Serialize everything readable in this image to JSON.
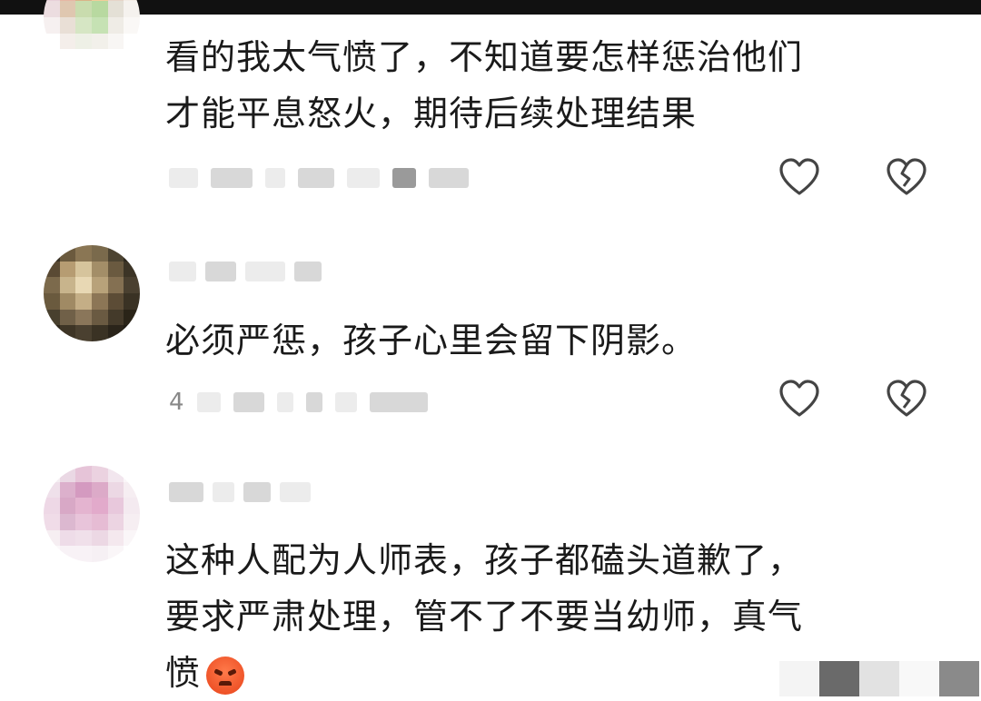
{
  "comments": [
    {
      "text_line1": "看的我太气愤了，不知道要怎样惩治他们",
      "text_line2": "才能平息怒火，期待后续处理结果",
      "meta_text": "",
      "avatar_colors": [
        "#f3e6e8",
        "#e9c9b8",
        "#f0d4a8",
        "#f7e1c0",
        "#efe5dc",
        "#f5f0ea",
        "#e8d0d8",
        "#e7b7a4",
        "#d9b488",
        "#f1cd98",
        "#e6d4c8",
        "#f3ece4",
        "#ecdde0",
        "#dfc7b0",
        "#c9dcae",
        "#b8d9a0",
        "#e4e0d6",
        "#f5f2ee",
        "#f6f0f0",
        "#e9dfd6",
        "#d6e6c4",
        "#c6e2b4",
        "#efece6",
        "#faf8f6",
        "#ffffff",
        "#f4eeea",
        "#eef0e6",
        "#f2f0ea",
        "#f8f6f4",
        "#ffffff",
        "#ffffff",
        "#ffffff",
        "#ffffff",
        "#ffffff",
        "#ffffff",
        "#ffffff"
      ]
    },
    {
      "text": "必须严惩，孩子心里会留下阴影。",
      "meta_text": "4",
      "avatar_colors": [
        "#3a3326",
        "#6b5a3e",
        "#8a7654",
        "#7a6a4c",
        "#4d4432",
        "#2e281e",
        "#5a4a34",
        "#b69c72",
        "#d6c49c",
        "#a38e68",
        "#6a5a40",
        "#3c3426",
        "#7c6a4c",
        "#c8b48c",
        "#e8d8b4",
        "#b8a27a",
        "#847052",
        "#4a4030",
        "#6a5a3e",
        "#a08a64",
        "#c4ae86",
        "#8c7656",
        "#5c4c36",
        "#3a3224",
        "#48402e",
        "#706048",
        "#8a765a",
        "#6a5a42",
        "#443a2a",
        "#2a2418",
        "#2e281c",
        "#3e3526",
        "#4a4030",
        "#3a3224",
        "#2a241a",
        "#201c14"
      ]
    },
    {
      "text_line1": "这种人配为人师表，孩子都磕头道歉了，",
      "text_line2": "要求严肃处理，管不了不要当幼师，真气",
      "text_line3": "愤",
      "meta_text": "",
      "avatar_colors": [
        "#f4eef2",
        "#ead8e4",
        "#e6c4d8",
        "#ebd2e0",
        "#f2e6ee",
        "#faf6f8",
        "#efe0ea",
        "#dcb0cc",
        "#d49ac0",
        "#dcaac8",
        "#ecd8e4",
        "#f6eef2",
        "#eed8e6",
        "#d8a8c6",
        "#e4b4d0",
        "#e2aacb",
        "#e8c8dc",
        "#f4eaf0",
        "#f0dce8",
        "#dcb8d0",
        "#e8c4da",
        "#e6bcd4",
        "#ecd4e2",
        "#f6eef2",
        "#f6eef2",
        "#eedce8",
        "#f0e0ea",
        "#ecd8e4",
        "#f4e8ee",
        "#faf6f8",
        "#fbf8fa",
        "#f8f2f6",
        "#f8f2f6",
        "#f6f0f4",
        "#faf6f8",
        "#ffffff"
      ]
    }
  ],
  "icons": {
    "like": "heart-outline-icon",
    "dislike": "broken-heart-icon",
    "emoji": "angry-face-emoji"
  }
}
